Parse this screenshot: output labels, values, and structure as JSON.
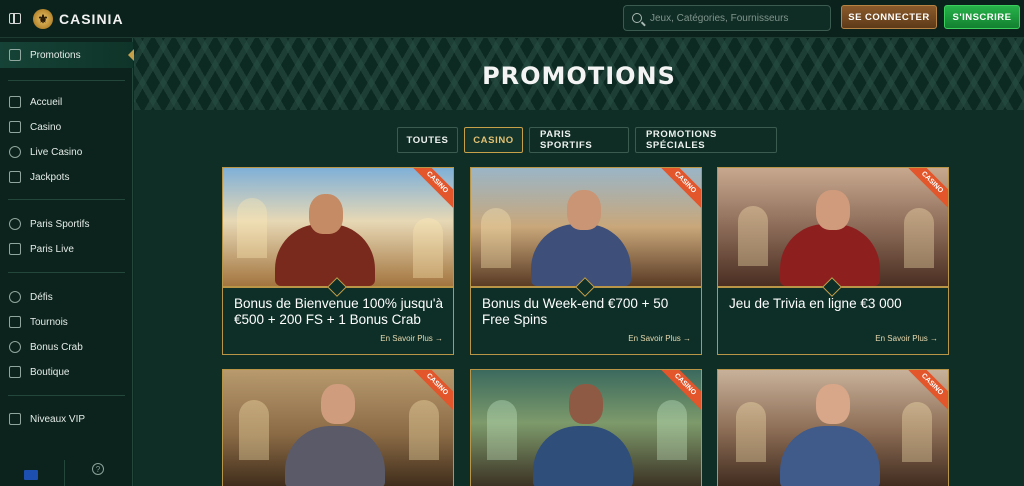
{
  "header": {
    "logo_text": "CASINIA",
    "search_placeholder": "Jeux, Catégories, Fournisseurs",
    "login_label": "SE CONNECTER",
    "register_label": "S'INSCRIRE"
  },
  "sidebar": {
    "active": "Promotions",
    "groups": [
      [
        "Accueil",
        "Casino",
        "Live Casino",
        "Jackpots"
      ],
      [
        "Paris Sportifs",
        "Paris Live"
      ],
      [
        "Défis",
        "Tournois",
        "Bonus Crab",
        "Boutique"
      ],
      [
        "Niveaux VIP"
      ]
    ],
    "help_label": "?"
  },
  "main": {
    "title": "PROMOTIONS",
    "tabs": [
      "TOUTES",
      "CASINO",
      "PARIS SPORTIFS",
      "PROMOTIONS SPÉCIALES"
    ],
    "active_tab": "CASINO",
    "cards": [
      {
        "ribbon": "CASINO",
        "title": "Bonus de Bienvenue 100% jusqu'à €500 + 200 FS + 1 Bonus Crab",
        "link": "En Savoir Plus →"
      },
      {
        "ribbon": "CASINO",
        "title": "Bonus du Week-end €700 + 50 Free Spins",
        "link": "En Savoir Plus →"
      },
      {
        "ribbon": "CASINO",
        "title": "Jeu de Trivia en ligne €3 000",
        "link": "En Savoir Plus →"
      },
      {
        "ribbon": "CASINO"
      },
      {
        "ribbon": "CASINO"
      },
      {
        "ribbon": "CASINO"
      }
    ]
  },
  "colors": {
    "background": "#0d2a22",
    "gold_accent": "#c7a04a",
    "register_green": "#26b34a",
    "login_brown": "#8a5a2b",
    "ribbon_orange": "#e3552b"
  }
}
